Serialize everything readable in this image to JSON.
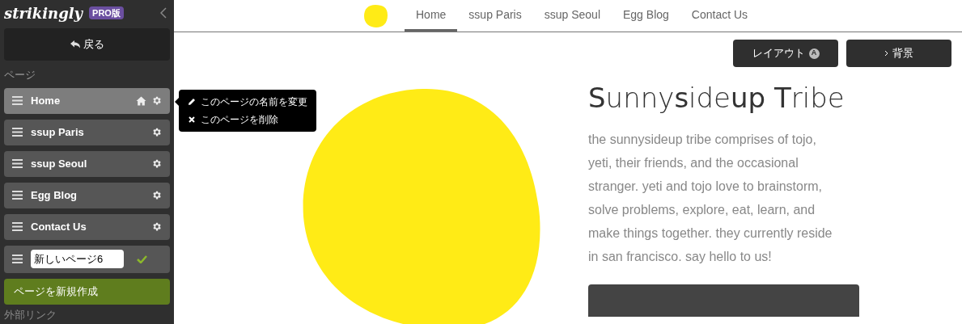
{
  "sidebar": {
    "logo": "strikingly",
    "badge": "PRO版",
    "back_button": "戻る",
    "section_label": "ページ",
    "pages": [
      {
        "label": "Home",
        "selected": true,
        "home": true
      },
      {
        "label": "ssup Paris",
        "selected": false,
        "home": false
      },
      {
        "label": "ssup Seoul",
        "selected": false,
        "home": false
      },
      {
        "label": "Egg Blog",
        "selected": false,
        "home": false
      },
      {
        "label": "Contact Us",
        "selected": false,
        "home": false
      }
    ],
    "new_page_input": {
      "value": "新しいページ6"
    },
    "create_button": "ページを新規作成",
    "section_label_2": "外部リンク"
  },
  "context_menu": {
    "items": [
      {
        "kind": "rename",
        "label": "このページの名前を変更"
      },
      {
        "kind": "delete",
        "label": "このページを削除"
      }
    ]
  },
  "nav": {
    "items": [
      {
        "label": "Home",
        "selected": true
      },
      {
        "label": "ssup Paris",
        "selected": false
      },
      {
        "label": "ssup Seoul",
        "selected": false
      },
      {
        "label": "Egg Blog",
        "selected": false
      },
      {
        "label": "Contact Us",
        "selected": false
      }
    ]
  },
  "toolbar": {
    "buttons": [
      {
        "kind": "layout",
        "label": "レイアウト",
        "badge": "A"
      },
      {
        "kind": "background",
        "label": "背景"
      }
    ]
  },
  "hero": {
    "title": "**S**unny**s**ide**up T**ribe",
    "body": "the sunnysideup tribe comprises of tojo, yeti, their friends, and the occasional stranger. yeti and tojo love to brainstorm, solve problems, explore, eat, learn, and make things together. they currently reside in san francisco. say hello to us!"
  }
}
